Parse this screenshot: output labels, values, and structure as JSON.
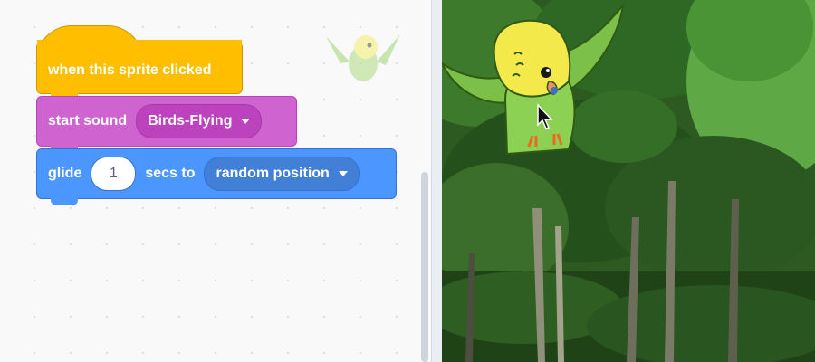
{
  "blocks": {
    "hat": {
      "label": "when this sprite clicked"
    },
    "sound": {
      "label": "start sound",
      "sound_name": "Birds-Flying"
    },
    "motion": {
      "label_before": "glide",
      "secs_value": "1",
      "label_after": "secs to",
      "target": "random position"
    }
  },
  "colors": {
    "events": "#ffbf00",
    "sound": "#cf63cf",
    "motion": "#4c97ff",
    "stage_backdrop": "#2f5a22"
  },
  "icons": {
    "sprite_thumbnail": "parrot-icon",
    "cursor": "mouse-pointer-icon"
  }
}
